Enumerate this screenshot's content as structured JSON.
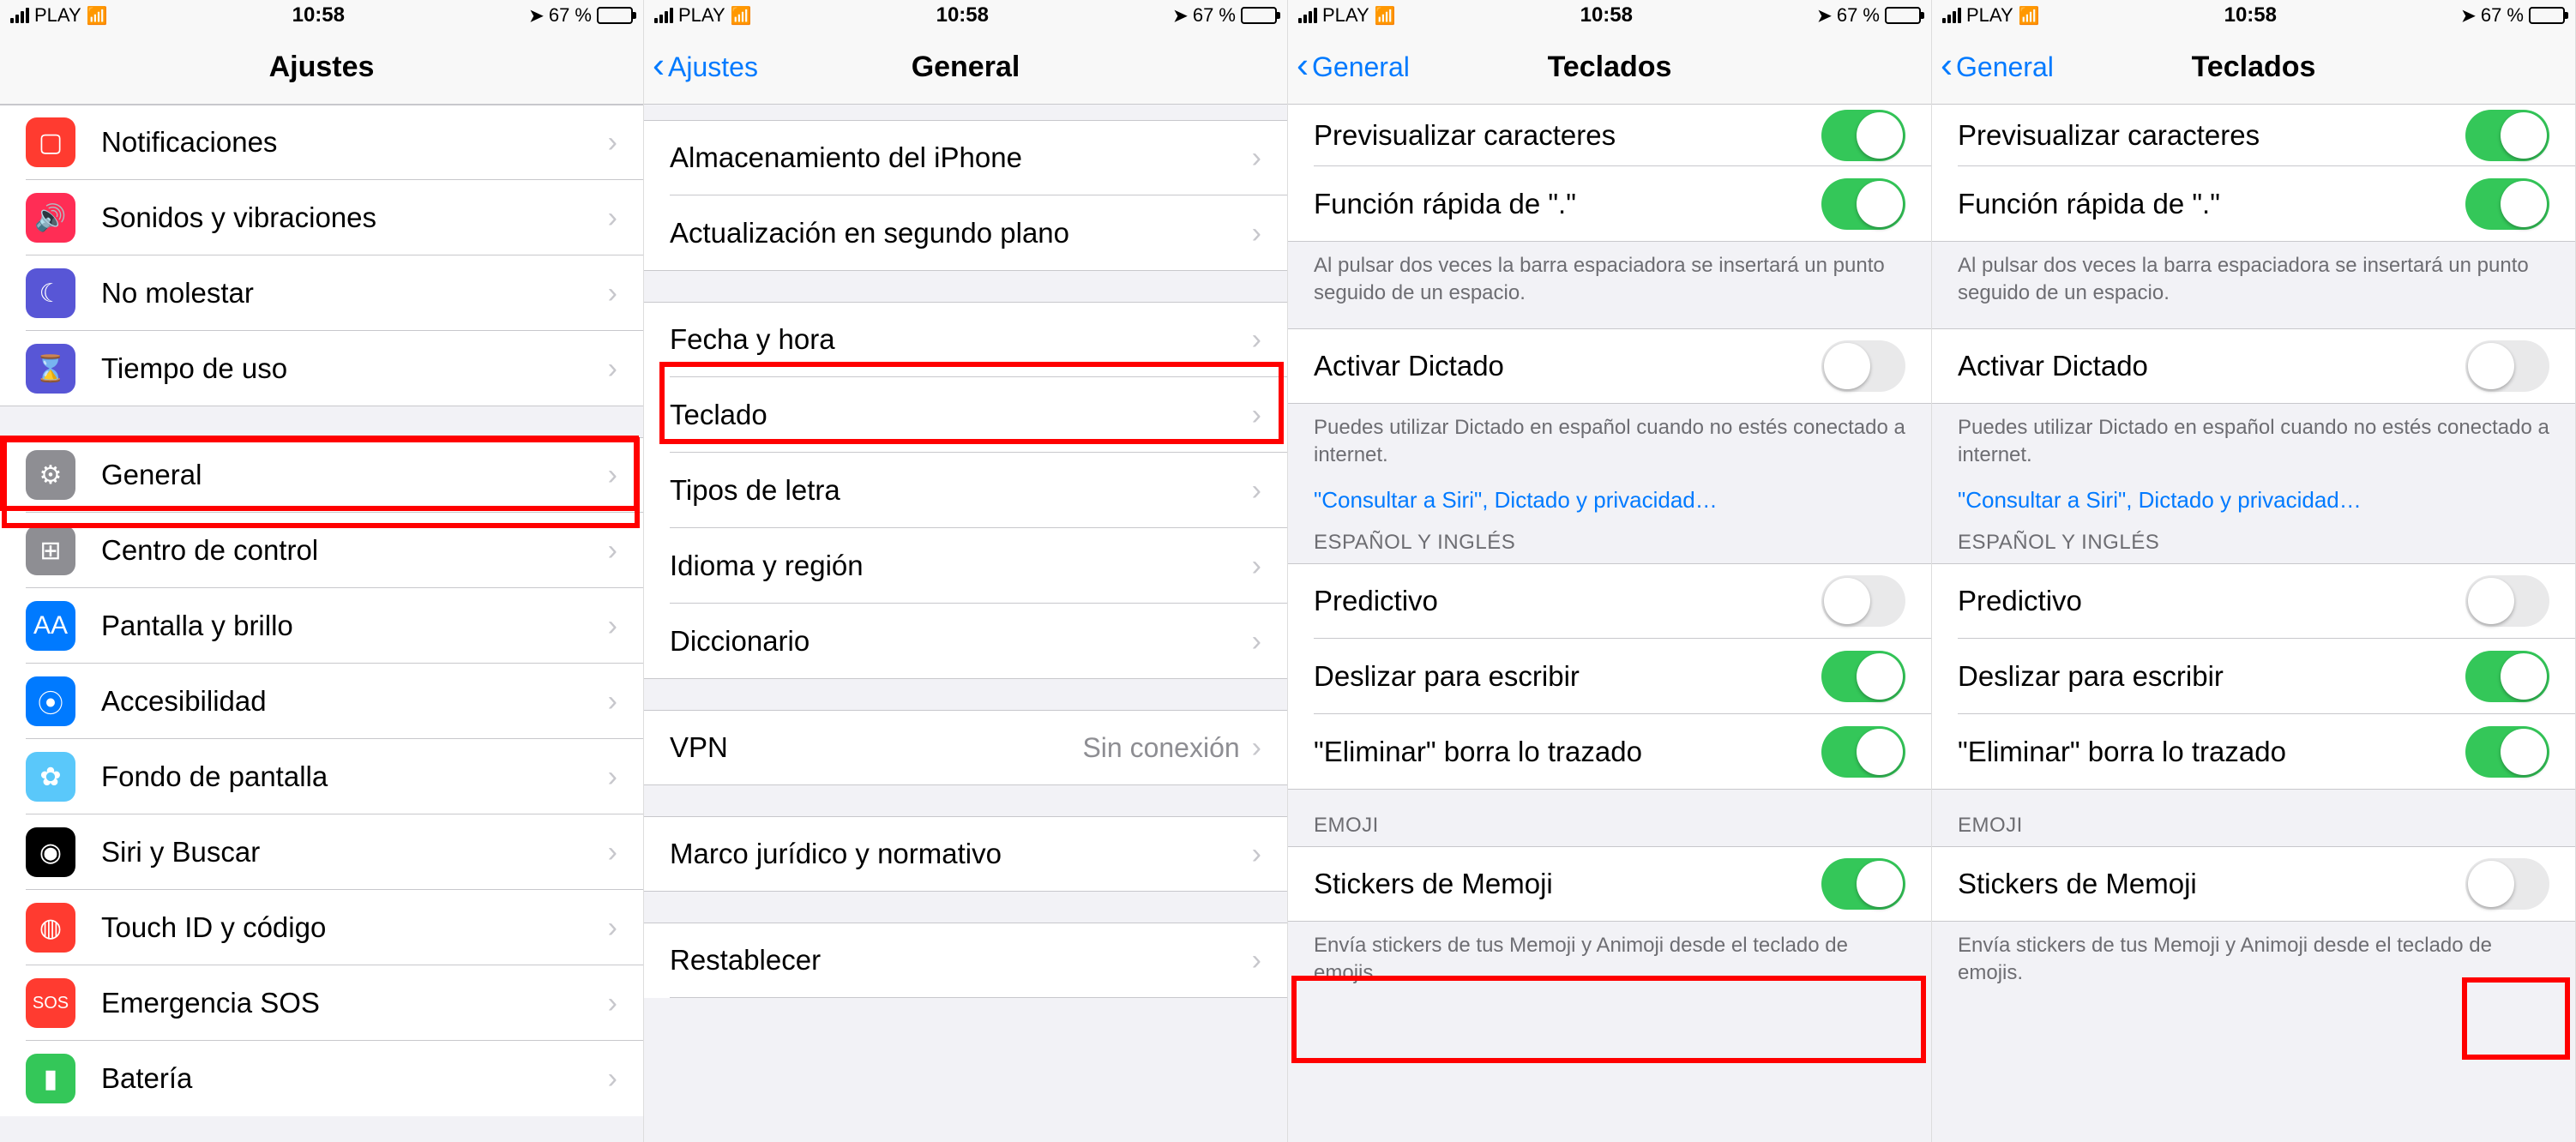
{
  "status": {
    "carrier": "PLAY",
    "time": "10:58",
    "battery_pct": "67 %",
    "nav_arrow": "➤"
  },
  "screen1": {
    "title": "Ajustes",
    "items_a": [
      {
        "label": "Notificaciones"
      },
      {
        "label": "Sonidos y vibraciones"
      },
      {
        "label": "No molestar"
      },
      {
        "label": "Tiempo de uso"
      }
    ],
    "items_b": [
      {
        "label": "General"
      },
      {
        "label": "Centro de control"
      },
      {
        "label": "Pantalla y brillo"
      },
      {
        "label": "Accesibilidad"
      },
      {
        "label": "Fondo de pantalla"
      },
      {
        "label": "Siri y Buscar"
      },
      {
        "label": "Touch ID y código"
      },
      {
        "label": "Emergencia SOS"
      },
      {
        "label": "Batería"
      }
    ]
  },
  "screen2": {
    "back": "Ajustes",
    "title": "General",
    "g1": [
      {
        "label": "Almacenamiento del iPhone"
      },
      {
        "label": "Actualización en segundo plano"
      }
    ],
    "g2": [
      {
        "label": "Fecha y hora"
      },
      {
        "label": "Teclado"
      },
      {
        "label": "Tipos de letra"
      },
      {
        "label": "Idioma y región"
      },
      {
        "label": "Diccionario"
      }
    ],
    "g3": [
      {
        "label": "VPN",
        "value": "Sin conexión"
      }
    ],
    "g4": [
      {
        "label": "Marco jurídico y normativo"
      }
    ],
    "g5": [
      {
        "label": "Restablecer"
      }
    ]
  },
  "screen3": {
    "back": "General",
    "title": "Teclados",
    "rows_top": [
      {
        "label": "Previsualizar caracteres",
        "on": true
      },
      {
        "label": "Función rápida de \".\"",
        "on": true
      }
    ],
    "footer_top": "Al pulsar dos veces la barra espaciadora se insertará un punto seguido de un espacio.",
    "dictation": {
      "label": "Activar Dictado",
      "on": false
    },
    "footer_dict": "Puedes utilizar Dictado en español cuando no estés conectado a internet.",
    "link": "\"Consultar a Siri\", Dictado y privacidad…",
    "header_lang": "ESPAÑOL Y INGLÉS",
    "rows_lang": [
      {
        "label": "Predictivo",
        "on": false
      },
      {
        "label": "Deslizar para escribir",
        "on": true
      },
      {
        "label": "\"Eliminar\" borra lo trazado",
        "on": true
      }
    ],
    "header_emoji": "EMOJI",
    "memoji": {
      "label": "Stickers de Memoji",
      "on": true
    },
    "footer_emoji": "Envía stickers de tus Memoji y Animoji desde el teclado de emojis."
  },
  "screen4": {
    "memoji_on": false
  }
}
